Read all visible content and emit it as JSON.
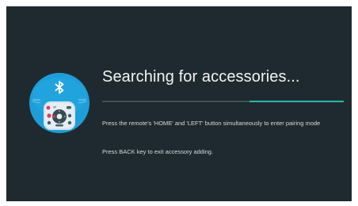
{
  "screen": {
    "title": "Searching for accessories...",
    "instruction": "Press the remote's 'HOME' and 'LEFT' button simultaneously to enter pairing mode",
    "back_hint": "Press BACK key to exit accessory adding.",
    "progress": {
      "segment_start_fraction": 0.61,
      "segment_end_fraction": 1.0
    },
    "illustration": {
      "icons": [
        "bluetooth-icon",
        "remote-control-icon"
      ]
    }
  },
  "colors": {
    "background": "#1f2a30",
    "accent": "#29b6ad",
    "circle": "#1e9ed9",
    "remote": "#d5e4ec"
  }
}
